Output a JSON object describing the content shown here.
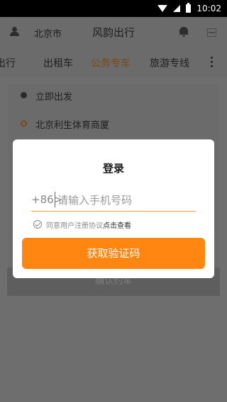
{
  "status_bar": {
    "time": "10:02"
  },
  "header": {
    "city": "北京市",
    "title": "风韵出行"
  },
  "tabs": [
    {
      "label": "出行",
      "active": false
    },
    {
      "label": "出租车",
      "active": false
    },
    {
      "label": "公务专车",
      "active": true
    },
    {
      "label": "旅游专线",
      "active": false
    }
  ],
  "main": {
    "depart_label": "立即出发",
    "from_label": "北京利生体育商厦",
    "confirm_label": "确认约车"
  },
  "login_modal": {
    "title": "登录",
    "prefix": "+86>",
    "phone_placeholder": "请输入手机号码",
    "phone_value": "",
    "agree_text": "同意用户注册协议",
    "agree_link": "点击查看",
    "agree_checked": false,
    "submit_label": "获取验证码"
  },
  "colors": {
    "accent": "#ff8611",
    "active_tab": "#7a4a10",
    "overlay": "#6b6b6b"
  }
}
